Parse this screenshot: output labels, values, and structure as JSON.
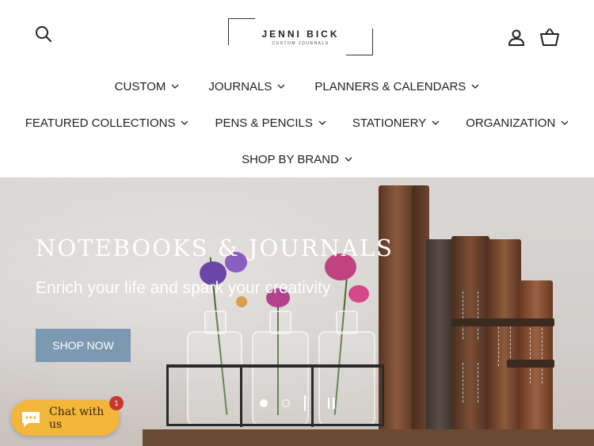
{
  "brand": {
    "name": "JENNI BICK",
    "tagline": "CUSTOM JOURNALS"
  },
  "header_icons": {
    "search": "search-icon",
    "account": "user-icon",
    "cart": "basket-icon"
  },
  "nav": {
    "row1": [
      {
        "label": "CUSTOM"
      },
      {
        "label": "JOURNALS"
      },
      {
        "label": "PLANNERS & CALENDARS"
      }
    ],
    "row2": [
      {
        "label": "FEATURED COLLECTIONS"
      },
      {
        "label": "PENS & PENCILS"
      },
      {
        "label": "STATIONERY"
      },
      {
        "label": "ORGANIZATION"
      }
    ],
    "row3": [
      {
        "label": "SHOP BY BRAND"
      }
    ]
  },
  "hero": {
    "title": "NOTEBOOKS & JOURNALS",
    "subtitle": "Enrich your life and spark your creativity",
    "cta": "SHOP NOW",
    "slides": {
      "count": 2,
      "active": 1
    }
  },
  "chat": {
    "label": "Chat with us",
    "badge": "1"
  },
  "colors": {
    "cta": "#7d99b1",
    "chat": "#f3b53a",
    "badge": "#c8392b"
  }
}
